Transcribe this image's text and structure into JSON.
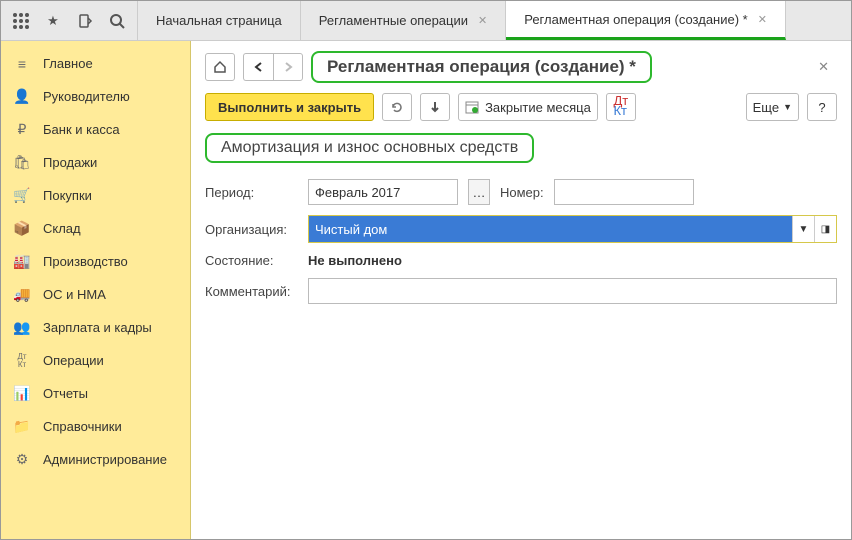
{
  "topbar": {
    "tabs": [
      {
        "label": "Начальная страница",
        "active": false,
        "closable": false
      },
      {
        "label": "Регламентные операции",
        "active": false,
        "closable": true
      },
      {
        "label": "Регламентная операция (создание) *",
        "active": true,
        "closable": true
      }
    ]
  },
  "sidebar": {
    "items": [
      {
        "label": "Главное",
        "icon": "≡"
      },
      {
        "label": "Руководителю",
        "icon": "👤"
      },
      {
        "label": "Банк и касса",
        "icon": "₽"
      },
      {
        "label": "Продажи",
        "icon": "🛍"
      },
      {
        "label": "Покупки",
        "icon": "🛒"
      },
      {
        "label": "Склад",
        "icon": "📦"
      },
      {
        "label": "Производство",
        "icon": "🏭"
      },
      {
        "label": "ОС и НМА",
        "icon": "🚚"
      },
      {
        "label": "Зарплата и кадры",
        "icon": "👥"
      },
      {
        "label": "Операции",
        "icon": "Дт Кт"
      },
      {
        "label": "Отчеты",
        "icon": "📊"
      },
      {
        "label": "Справочники",
        "icon": "📁"
      },
      {
        "label": "Администрирование",
        "icon": "⚙"
      }
    ]
  },
  "page": {
    "title": "Регламентная операция (создание) *",
    "subtitle": "Амортизация и износ основных средств"
  },
  "toolbar": {
    "execute_close": "Выполнить и закрыть",
    "closing_month": "Закрытие месяца",
    "more": "Еще",
    "help": "?"
  },
  "form": {
    "period_label": "Период:",
    "period_value": "Февраль 2017",
    "number_label": "Номер:",
    "number_value": "",
    "org_label": "Организация:",
    "org_value": "Чистый дом",
    "state_label": "Состояние:",
    "state_value": "Не выполнено",
    "comment_label": "Комментарий:",
    "comment_value": ""
  }
}
